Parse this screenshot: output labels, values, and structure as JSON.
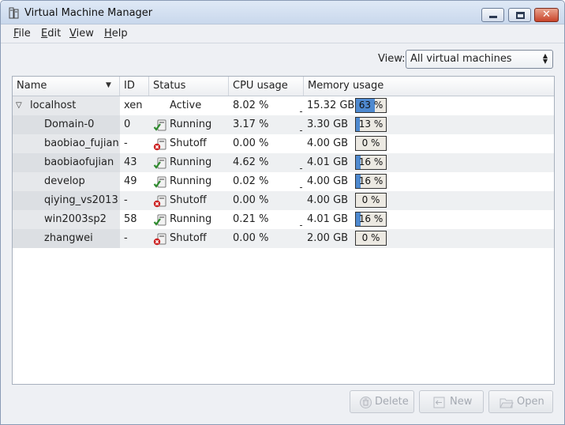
{
  "window": {
    "title": "Virtual Machine Manager"
  },
  "menu": [
    {
      "label": "File",
      "u": "F",
      "rest": "ile"
    },
    {
      "label": "Edit",
      "u": "E",
      "rest": "dit"
    },
    {
      "label": "View",
      "u": "V",
      "rest": "iew"
    },
    {
      "label": "Help",
      "u": "H",
      "rest": "elp"
    }
  ],
  "filter": {
    "label": "View:",
    "value": "All virtual machines"
  },
  "columns": {
    "name": "Name",
    "id": "ID",
    "status": "Status",
    "cpu": "CPU usage",
    "memory": "Memory usage"
  },
  "rows": [
    {
      "name": "localhost",
      "id": "xen",
      "status": "Active",
      "cpu": "8.02 %",
      "mem": "15.32 GB",
      "mem_pct_label": "63 %",
      "mem_pct": 63,
      "icon": "host",
      "host": true
    },
    {
      "name": "Domain-0",
      "id": "0",
      "status": "Running",
      "cpu": "3.17 %",
      "mem": "3.30 GB",
      "mem_pct_label": "13 %",
      "mem_pct": 13,
      "icon": "running-icon"
    },
    {
      "name": "baobiao_fujian",
      "id": "-",
      "status": "Shutoff",
      "cpu": "0.00 %",
      "mem": "4.00 GB",
      "mem_pct_label": "0 %",
      "mem_pct": 0,
      "icon": "shutoff-icon"
    },
    {
      "name": "baobiaofujian",
      "id": "43",
      "status": "Running",
      "cpu": "4.62 %",
      "mem": "4.01 GB",
      "mem_pct_label": "16 %",
      "mem_pct": 16,
      "icon": "running-icon"
    },
    {
      "name": "develop",
      "id": "49",
      "status": "Running",
      "cpu": "0.02 %",
      "mem": "4.00 GB",
      "mem_pct_label": "16 %",
      "mem_pct": 16,
      "icon": "running-icon"
    },
    {
      "name": "qiying_vs2013",
      "id": "-",
      "status": "Shutoff",
      "cpu": "0.00 %",
      "mem": "4.00 GB",
      "mem_pct_label": "0 %",
      "mem_pct": 0,
      "icon": "shutoff-icon"
    },
    {
      "name": "win2003sp2",
      "id": "58",
      "status": "Running",
      "cpu": "0.21 %",
      "mem": "4.01 GB",
      "mem_pct_label": "16 %",
      "mem_pct": 16,
      "icon": "running-icon"
    },
    {
      "name": "zhangwei",
      "id": "-",
      "status": "Shutoff",
      "cpu": "0.00 %",
      "mem": "2.00 GB",
      "mem_pct_label": "0 %",
      "mem_pct": 0,
      "icon": "shutoff-icon"
    }
  ],
  "buttons": {
    "delete": "Delete",
    "new": "New",
    "open": "Open"
  },
  "colors": {
    "memory_bar": "#4f8ad0",
    "running_check": "#2e8b2e",
    "shutoff_x": "#cc2222"
  }
}
